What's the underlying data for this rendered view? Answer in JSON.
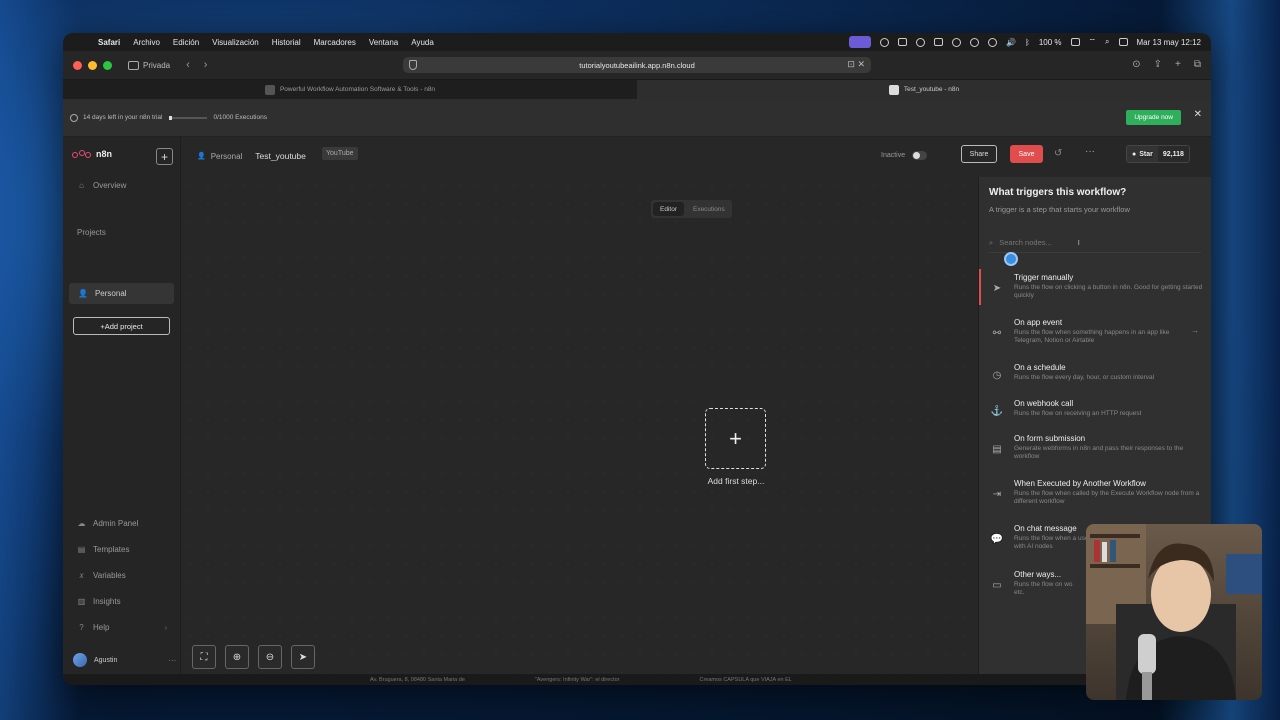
{
  "menubar": {
    "items": [
      "Safari",
      "Archivo",
      "Edición",
      "Visualización",
      "Historial",
      "Marcadores",
      "Ventana",
      "Ayuda"
    ],
    "battery": "100 %",
    "clock": "Mar 13 may 12:12"
  },
  "browser": {
    "private_label": "Privada",
    "url": "tutorialyoutubeailink.app.n8n.cloud",
    "tabs": [
      {
        "title": "Powerful Workflow Automation Software & Tools - n8n",
        "active": false
      },
      {
        "title": "Test_youtube - n8n",
        "active": true
      }
    ]
  },
  "trial": {
    "days_left": "14 days left in your n8n trial",
    "executions": "0/1000 Executions",
    "upgrade_label": "Upgrade now"
  },
  "sidebar": {
    "logo": "n8n",
    "overview": "Overview",
    "projects_heading": "Projects",
    "personal": "Personal",
    "add_project": "Add project",
    "bottom": [
      "Admin Panel",
      "Templates",
      "Variables",
      "Insights",
      "Help"
    ],
    "user": "Agustin"
  },
  "header": {
    "breadcrumb_owner": "Personal",
    "workflow_name": "Test_youtube",
    "tag": "YouTube",
    "status": "Inactive",
    "share": "Share",
    "save": "Save",
    "star": "Star",
    "star_count": "92,118"
  },
  "modes": [
    "Editor",
    "Executions"
  ],
  "canvas": {
    "add_first_step": "Add first step..."
  },
  "panel": {
    "title": "What triggers this workflow?",
    "subtitle": "A trigger is a step that starts your workflow",
    "search_placeholder": "Search nodes...",
    "items": [
      {
        "title": "Trigger manually",
        "desc": "Runs the flow on clicking a button in n8n. Good for getting started quickly",
        "icon": "cursor-icon"
      },
      {
        "title": "On app event",
        "desc": "Runs the flow when something happens in an app like Telegram, Notion or Airtable",
        "icon": "app-event-icon"
      },
      {
        "title": "On a schedule",
        "desc": "Runs the flow every day, hour, or custom interval",
        "icon": "clock-icon"
      },
      {
        "title": "On webhook call",
        "desc": "Runs the flow on receiving an HTTP request",
        "icon": "webhook-icon"
      },
      {
        "title": "On form submission",
        "desc": "Generate webforms in n8n and pass their responses to the workflow",
        "icon": "form-icon"
      },
      {
        "title": "When Executed by Another Workflow",
        "desc": "Runs the flow when called by the Execute Workflow node from a different workflow",
        "icon": "sign-in-icon"
      },
      {
        "title": "On chat message",
        "desc": "Runs the flow when a use with AI nodes",
        "icon": "chat-icon"
      },
      {
        "title": "Other ways...",
        "desc": "Runs the flow on wo etc.",
        "icon": "folder-icon"
      }
    ]
  },
  "strip": [
    "Av. Bruguera, 8, 08480 Santa Maria de",
    "\"Avengers: Infinity War\": el director",
    "Creamos CAPSULA que VIAJA en EL"
  ],
  "colors": {
    "save": "#e14c4c",
    "upgrade": "#2fae5b",
    "accent_logo": "#ea4b71"
  }
}
